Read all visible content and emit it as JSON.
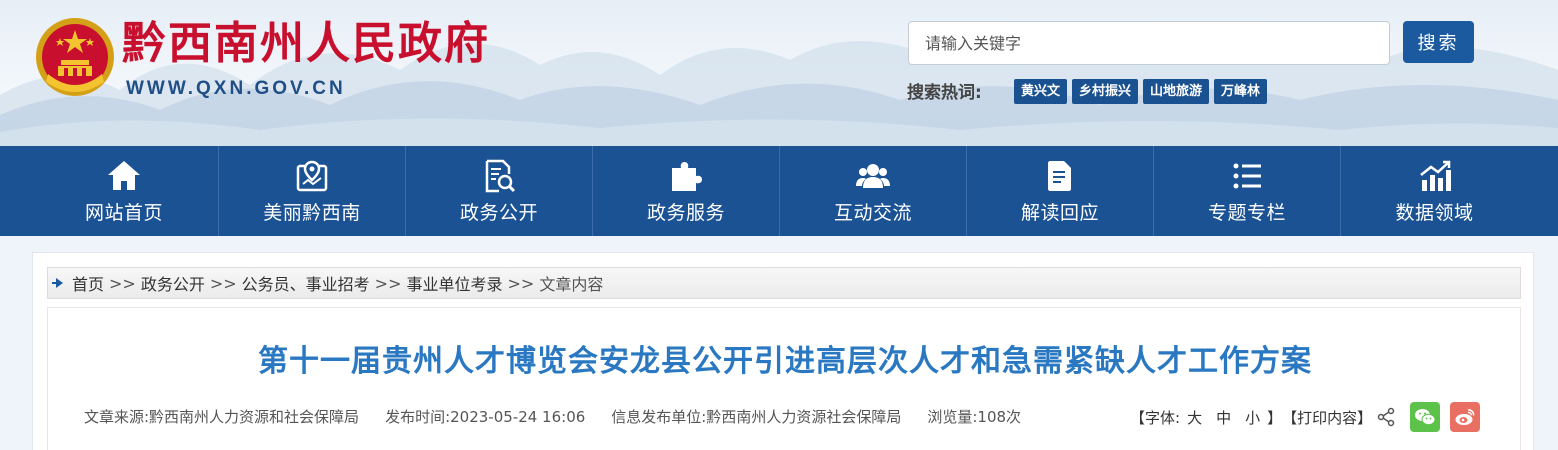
{
  "header": {
    "site_name": "黔西南州人民政府",
    "site_domain": "WWW.QXN.GOV.CN",
    "search_placeholder": "请输入关键字",
    "search_button": "搜索",
    "hot_label": "搜索热词:",
    "hot_tags": [
      "黄兴文",
      "乡村振兴",
      "山地旅游",
      "万峰林"
    ]
  },
  "nav": {
    "items": [
      {
        "label": "网站首页",
        "icon": "home-icon"
      },
      {
        "label": "美丽黔西南",
        "icon": "map-pin-icon"
      },
      {
        "label": "政务公开",
        "icon": "document-search-icon"
      },
      {
        "label": "政务服务",
        "icon": "puzzle-icon"
      },
      {
        "label": "互动交流",
        "icon": "users-icon"
      },
      {
        "label": "解读回应",
        "icon": "file-icon"
      },
      {
        "label": "专题专栏",
        "icon": "list-icon"
      },
      {
        "label": "数据领域",
        "icon": "bar-chart-icon"
      }
    ]
  },
  "breadcrumb": {
    "items": [
      "首页",
      "政务公开",
      "公务员、事业招考",
      "事业单位考录"
    ],
    "separator": ">>",
    "current": "文章内容"
  },
  "article": {
    "title": "第十一届贵州人才博览会安龙县公开引进高层次人才和急需紧缺人才工作方案",
    "source": "文章来源:黔西南州人力资源和社会保障局",
    "publish_time": "发布时间:2023-05-24 16:06",
    "publisher": "信息发布单位:黔西南州人力资源社会保障局",
    "views": "浏览量:108次"
  },
  "tools": {
    "font_label": "【字体:",
    "font_large": "大",
    "font_medium": "中",
    "font_small": "小",
    "font_close": "】",
    "print": "【打印内容】"
  },
  "colors": {
    "nav_bg": "#1a5294",
    "brand_red": "#c8102e",
    "title_blue": "#2a78c2",
    "wechat_green": "#5cc24a",
    "weibo_red": "#ea6f63"
  }
}
